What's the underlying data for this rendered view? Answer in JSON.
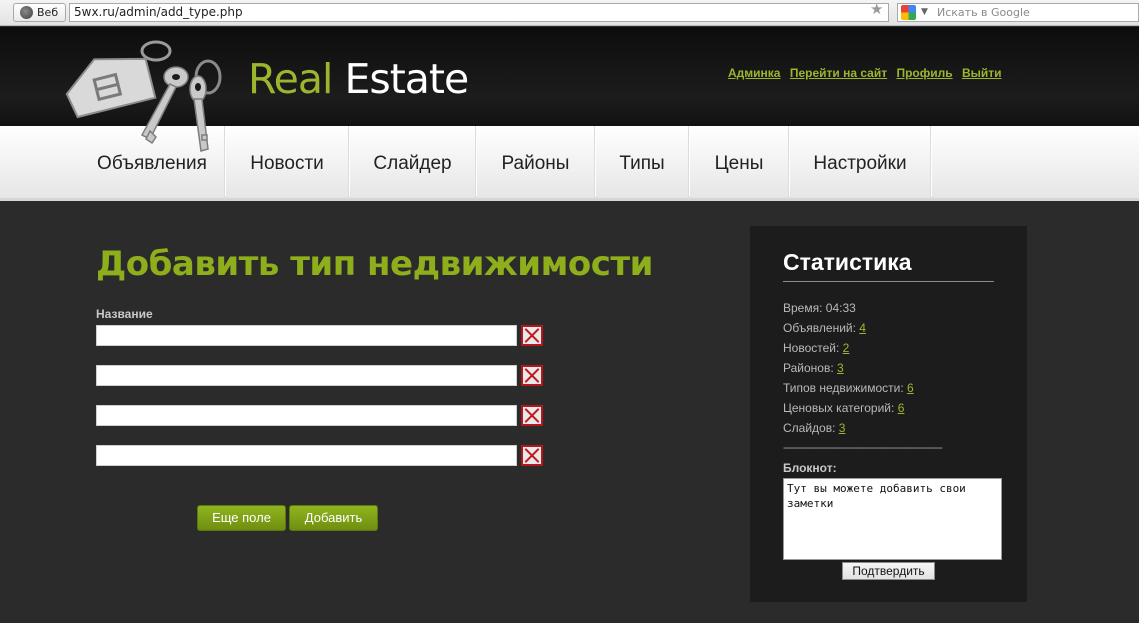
{
  "browser": {
    "web_label": "Веб",
    "url": "5wx.ru/admin/add_type.php",
    "search_placeholder": "Искать в Google"
  },
  "header": {
    "brand_part1": "Real",
    "brand_part2": "Estate",
    "links": [
      "Админка",
      "Перейти на сайт",
      "Профиль",
      "Выйти"
    ]
  },
  "nav": {
    "items": [
      "Объявления",
      "Новости",
      "Слайдер",
      "Районы",
      "Типы",
      "Цены",
      "Настройки"
    ]
  },
  "form": {
    "title": "Добавить тип недвижимости",
    "field_label": "Название",
    "fields": [
      "",
      "",
      "",
      ""
    ],
    "add_field_label": "Еще поле",
    "submit_label": "Добавить"
  },
  "stats": {
    "title": "Статистика",
    "time_label": "Время: ",
    "time_value": "04:33",
    "ads_label": "Объявлений: ",
    "ads_value": "4",
    "news_label": "Новостей: ",
    "news_value": "2",
    "districts_label": "Районов: ",
    "districts_value": "3",
    "types_label": "Типов недвижимости: ",
    "types_value": "6",
    "prices_label": "Ценовых категорий: ",
    "prices_value": "6",
    "slides_label": "Слайдов: ",
    "slides_value": "3",
    "separator": "-----------------------------------------------------",
    "notepad_label": "Блокнот:",
    "notepad_text": "Тут вы можете добавить свои заметки",
    "confirm_label": "Подтвердить"
  },
  "colors": {
    "accent": "#9bb62e",
    "title_green": "#8fae1b",
    "background": "#2b2b2b",
    "panel": "#1c1c1c"
  }
}
